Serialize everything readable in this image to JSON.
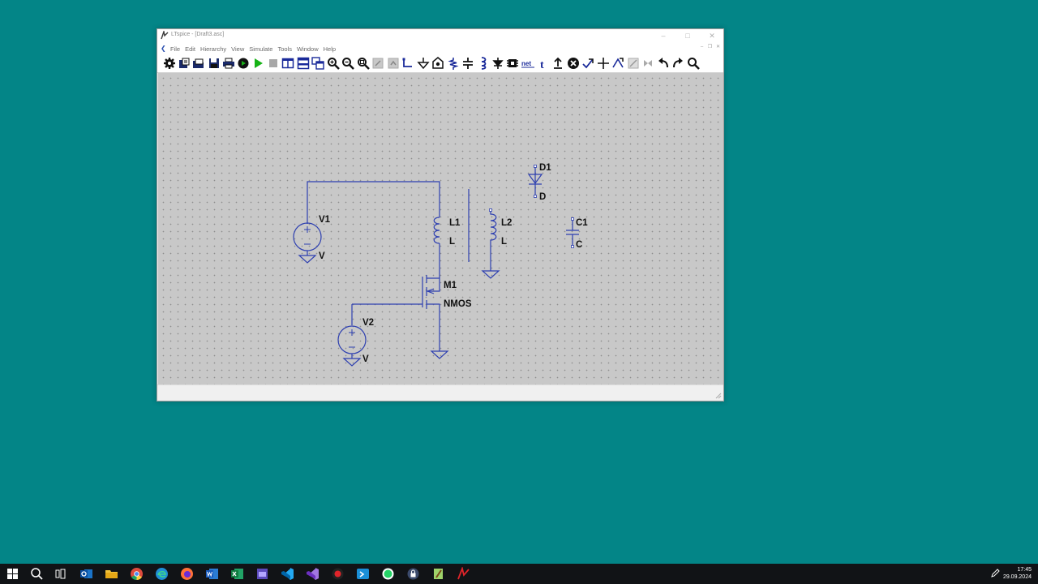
{
  "window": {
    "title": "LTspice - [Draft3.asc]",
    "menu": [
      "File",
      "Edit",
      "Hierarchy",
      "View",
      "Simulate",
      "Tools",
      "Window",
      "Help"
    ]
  },
  "toolbar": {
    "tools": [
      "settings-icon",
      "open-folder-icon",
      "open-file-icon",
      "save-icon",
      "print-icon",
      "run-icon",
      "play-icon",
      "stop-icon",
      "tile-vertical-icon",
      "tile-horizontal-icon",
      "cascade-icon",
      "zoom-in-icon",
      "zoom-out-icon",
      "zoom-fit-icon",
      "zoom-area-icon",
      "autoscale-icon",
      "wire-icon",
      "ground-icon",
      "label-net-icon",
      "resistor-icon",
      "capacitor-icon",
      "inductor-icon",
      "diode-icon",
      "component-icon",
      "netlist-icon",
      "text-icon",
      "spice-directive-icon",
      "delete-icon",
      "duplicate-icon",
      "move-icon",
      "drag-icon",
      "rotate-icon",
      "mirror-icon",
      "undo-icon",
      "redo-icon",
      "find-icon"
    ]
  },
  "schematic": {
    "components": [
      {
        "ref": "V1",
        "value": "V"
      },
      {
        "ref": "L1",
        "value": "L"
      },
      {
        "ref": "L2",
        "value": "L"
      },
      {
        "ref": "D1",
        "value": "D"
      },
      {
        "ref": "C1",
        "value": "C"
      },
      {
        "ref": "M1",
        "value": "NMOS"
      },
      {
        "ref": "V2",
        "value": "V"
      }
    ],
    "wire_color": "#2d3fb0"
  },
  "taskbar": {
    "apps": [
      "windows-start-icon",
      "search-icon",
      "task-view-icon",
      "outlook-icon",
      "file-explorer-icon",
      "chrome-icon",
      "edge-icon",
      "firefox-icon",
      "word-icon",
      "excel-icon",
      "visual-studio-icon",
      "vscode-icon",
      "visual-studio-purple-icon",
      "obs-record-icon",
      "remote-app-icon",
      "whatsapp-icon",
      "vpn-lock-icon",
      "notepadpp-icon",
      "ltspice-icon"
    ],
    "time": "17:45",
    "date": "29.09.2024"
  }
}
